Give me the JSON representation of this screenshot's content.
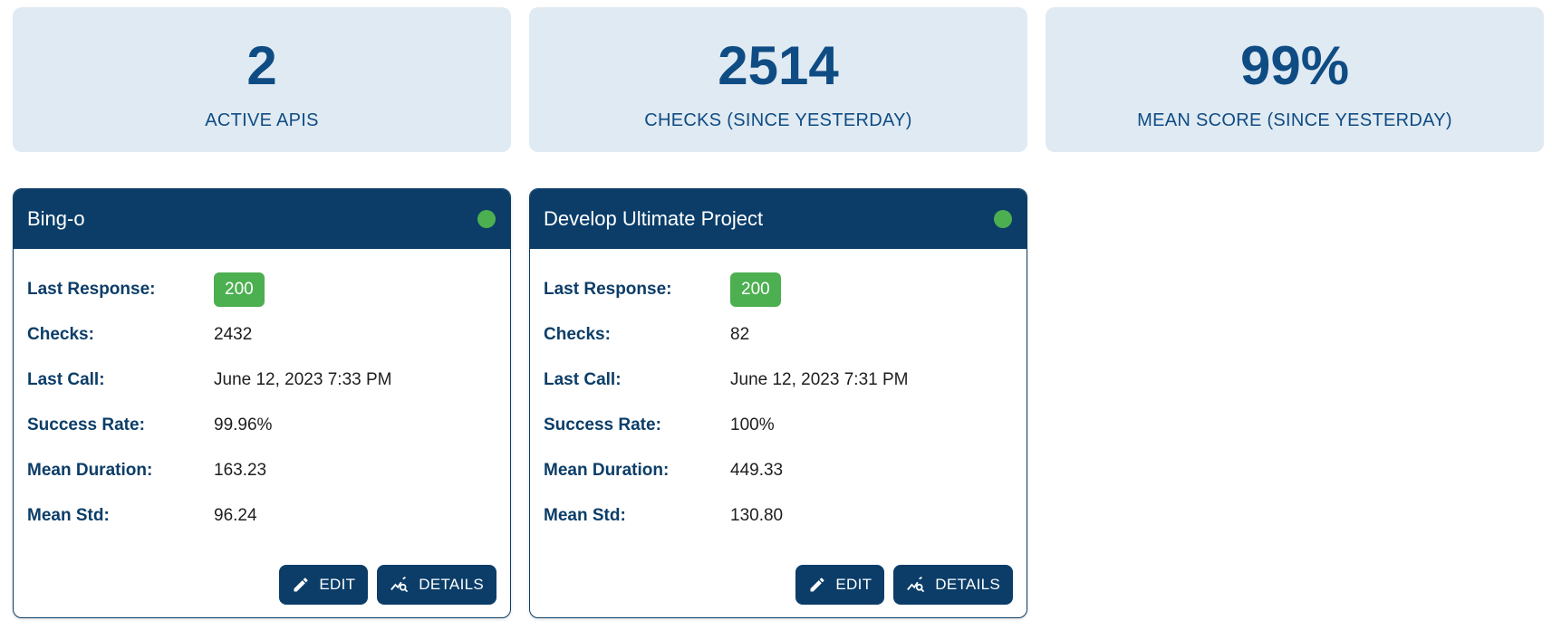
{
  "stats": [
    {
      "value": "2",
      "label": "ACTIVE APIS"
    },
    {
      "value": "2514",
      "label": "CHECKS (SINCE YESTERDAY)"
    },
    {
      "value": "99%",
      "label": "MEAN SCORE (SINCE YESTERDAY)"
    }
  ],
  "labels": {
    "last_response": "Last Response:",
    "checks": "Checks:",
    "last_call": "Last Call:",
    "success_rate": "Success Rate:",
    "mean_duration": "Mean Duration:",
    "mean_std": "Mean Std:",
    "edit": "EDIT",
    "details": "DETAILS"
  },
  "apis": [
    {
      "name": "Bing-o",
      "status_color": "#4caf50",
      "last_response": "200",
      "checks": "2432",
      "last_call": "June 12, 2023 7:33 PM",
      "success_rate": "99.96%",
      "mean_duration": "163.23",
      "mean_std": "96.24"
    },
    {
      "name": "Develop Ultimate Project",
      "status_color": "#4caf50",
      "last_response": "200",
      "checks": "82",
      "last_call": "June 12, 2023 7:31 PM",
      "success_rate": "100%",
      "mean_duration": "449.33",
      "mean_std": "130.80"
    }
  ],
  "icons": {
    "edit": "pencil-icon",
    "details": "chart-search-icon"
  },
  "colors": {
    "primary": "#0b3d68",
    "stat_bg": "#e0eaf2",
    "success": "#4caf50"
  }
}
